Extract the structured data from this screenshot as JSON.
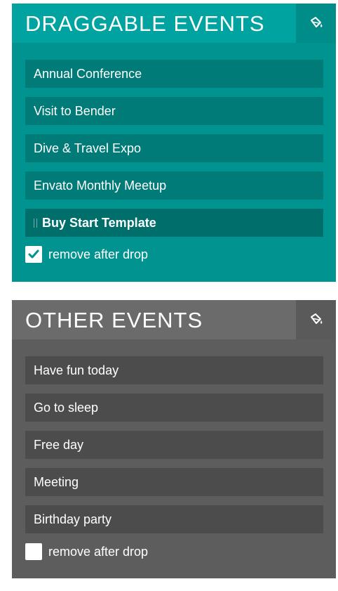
{
  "draggable_panel": {
    "title": "DRAGGABLE EVENTS",
    "tool_icon": "paint-bucket-icon",
    "events": [
      {
        "label": "Annual Conference"
      },
      {
        "label": "Visit to Bender"
      },
      {
        "label": "Dive & Travel Expo"
      },
      {
        "label": "Envato Monthly Meetup"
      },
      {
        "label": "Buy Start Template",
        "state": "dragging"
      }
    ],
    "remove_after_drop": {
      "label": "remove after drop",
      "checked": true
    }
  },
  "other_panel": {
    "title": "OTHER EVENTS",
    "tool_icon": "paint-bucket-icon",
    "events": [
      {
        "label": "Have fun today"
      },
      {
        "label": "Go to sleep"
      },
      {
        "label": "Free day"
      },
      {
        "label": "Meeting"
      },
      {
        "label": "Birthday party"
      }
    ],
    "remove_after_drop": {
      "label": "remove after drop",
      "checked": false
    }
  },
  "colors": {
    "draggable_bg": "#00938f",
    "draggable_header": "#00a3a0",
    "draggable_item": "#007b78",
    "other_bg": "#5d5d5d",
    "other_header": "#6b6b6b",
    "other_item": "#4c4c4c"
  }
}
